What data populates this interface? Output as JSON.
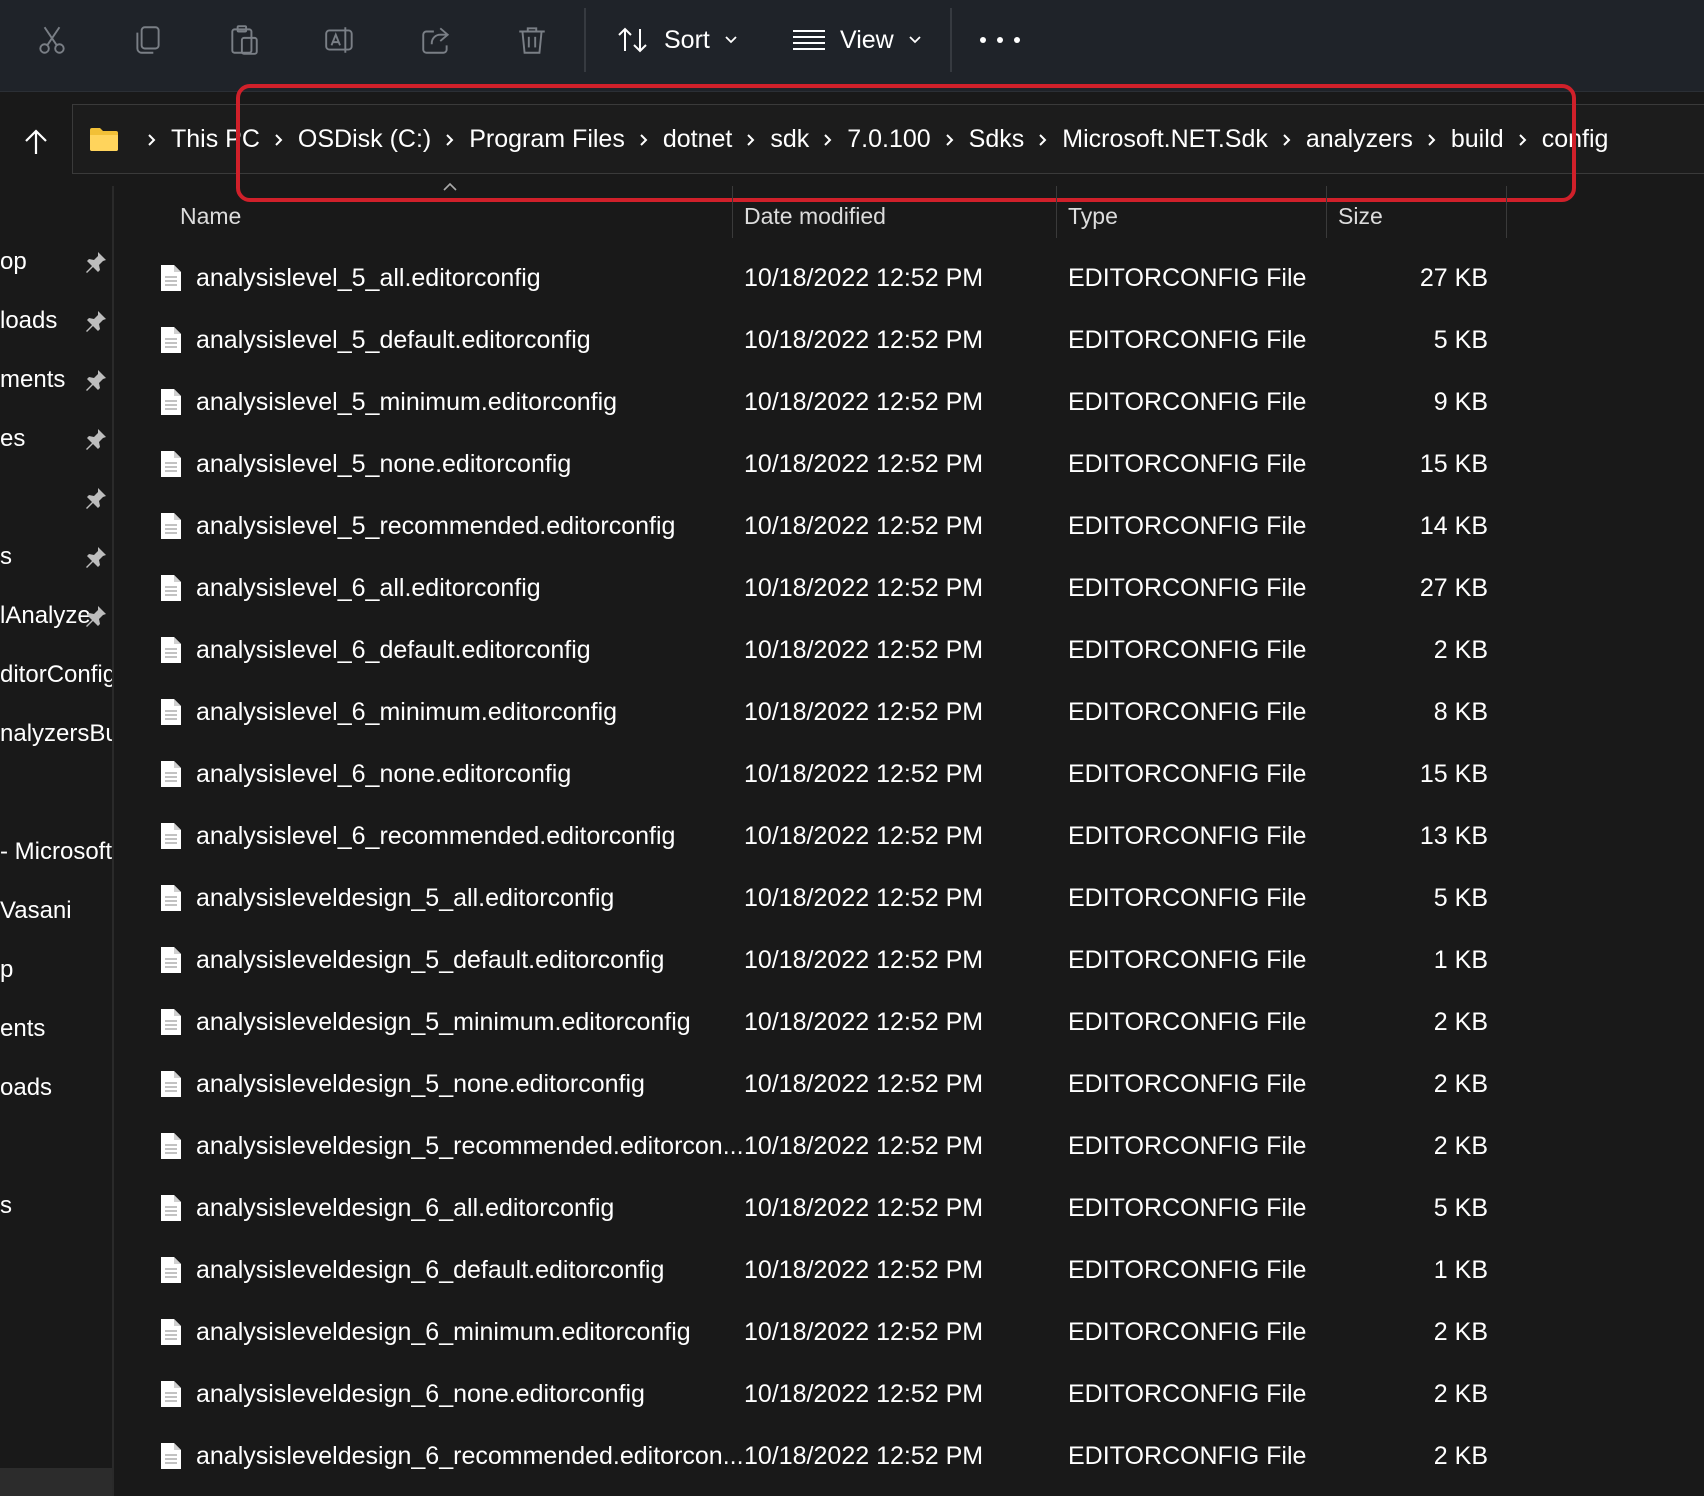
{
  "toolbar": {
    "icons": [
      "cut-icon",
      "copy-icon",
      "paste-icon",
      "rename-icon",
      "share-icon",
      "delete-icon"
    ],
    "sort_label": "Sort",
    "view_label": "View",
    "more_label": "See more"
  },
  "address": {
    "crumbs": [
      "This PC",
      "OSDisk (C:)",
      "Program Files",
      "dotnet",
      "sdk",
      "7.0.100",
      "Sdks",
      "Microsoft.NET.Sdk",
      "analyzers",
      "build",
      "config"
    ]
  },
  "nav": {
    "items": [
      "op",
      "loads",
      "ments",
      "es",
      "",
      "s",
      "lAnalyze",
      "ditorConfig",
      "nalyzersBug",
      " - Microsoft",
      "Vasani",
      "p",
      "ents",
      "oads",
      "s"
    ]
  },
  "columns": {
    "name": "Name",
    "date": "Date modified",
    "type": "Type",
    "size": "Size"
  },
  "files": [
    {
      "name": "analysislevel_5_all.editorconfig",
      "date": "10/18/2022 12:52 PM",
      "type": "EDITORCONFIG File",
      "size": "27 KB"
    },
    {
      "name": "analysislevel_5_default.editorconfig",
      "date": "10/18/2022 12:52 PM",
      "type": "EDITORCONFIG File",
      "size": "5 KB"
    },
    {
      "name": "analysislevel_5_minimum.editorconfig",
      "date": "10/18/2022 12:52 PM",
      "type": "EDITORCONFIG File",
      "size": "9 KB"
    },
    {
      "name": "analysislevel_5_none.editorconfig",
      "date": "10/18/2022 12:52 PM",
      "type": "EDITORCONFIG File",
      "size": "15 KB"
    },
    {
      "name": "analysislevel_5_recommended.editorconfig",
      "date": "10/18/2022 12:52 PM",
      "type": "EDITORCONFIG File",
      "size": "14 KB"
    },
    {
      "name": "analysislevel_6_all.editorconfig",
      "date": "10/18/2022 12:52 PM",
      "type": "EDITORCONFIG File",
      "size": "27 KB"
    },
    {
      "name": "analysislevel_6_default.editorconfig",
      "date": "10/18/2022 12:52 PM",
      "type": "EDITORCONFIG File",
      "size": "2 KB"
    },
    {
      "name": "analysislevel_6_minimum.editorconfig",
      "date": "10/18/2022 12:52 PM",
      "type": "EDITORCONFIG File",
      "size": "8 KB"
    },
    {
      "name": "analysislevel_6_none.editorconfig",
      "date": "10/18/2022 12:52 PM",
      "type": "EDITORCONFIG File",
      "size": "15 KB"
    },
    {
      "name": "analysislevel_6_recommended.editorconfig",
      "date": "10/18/2022 12:52 PM",
      "type": "EDITORCONFIG File",
      "size": "13 KB"
    },
    {
      "name": "analysisleveldesign_5_all.editorconfig",
      "date": "10/18/2022 12:52 PM",
      "type": "EDITORCONFIG File",
      "size": "5 KB"
    },
    {
      "name": "analysisleveldesign_5_default.editorconfig",
      "date": "10/18/2022 12:52 PM",
      "type": "EDITORCONFIG File",
      "size": "1 KB"
    },
    {
      "name": "analysisleveldesign_5_minimum.editorconfig",
      "date": "10/18/2022 12:52 PM",
      "type": "EDITORCONFIG File",
      "size": "2 KB"
    },
    {
      "name": "analysisleveldesign_5_none.editorconfig",
      "date": "10/18/2022 12:52 PM",
      "type": "EDITORCONFIG File",
      "size": "2 KB"
    },
    {
      "name": "analysisleveldesign_5_recommended.editorcon...",
      "date": "10/18/2022 12:52 PM",
      "type": "EDITORCONFIG File",
      "size": "2 KB"
    },
    {
      "name": "analysisleveldesign_6_all.editorconfig",
      "date": "10/18/2022 12:52 PM",
      "type": "EDITORCONFIG File",
      "size": "5 KB"
    },
    {
      "name": "analysisleveldesign_6_default.editorconfig",
      "date": "10/18/2022 12:52 PM",
      "type": "EDITORCONFIG File",
      "size": "1 KB"
    },
    {
      "name": "analysisleveldesign_6_minimum.editorconfig",
      "date": "10/18/2022 12:52 PM",
      "type": "EDITORCONFIG File",
      "size": "2 KB"
    },
    {
      "name": "analysisleveldesign_6_none.editorconfig",
      "date": "10/18/2022 12:52 PM",
      "type": "EDITORCONFIG File",
      "size": "2 KB"
    },
    {
      "name": "analysisleveldesign_6_recommended.editorcon...",
      "date": "10/18/2022 12:52 PM",
      "type": "EDITORCONFIG File",
      "size": "2 KB"
    }
  ],
  "colors": {
    "highlight": "#d0202a",
    "folder": "#f2c037"
  }
}
